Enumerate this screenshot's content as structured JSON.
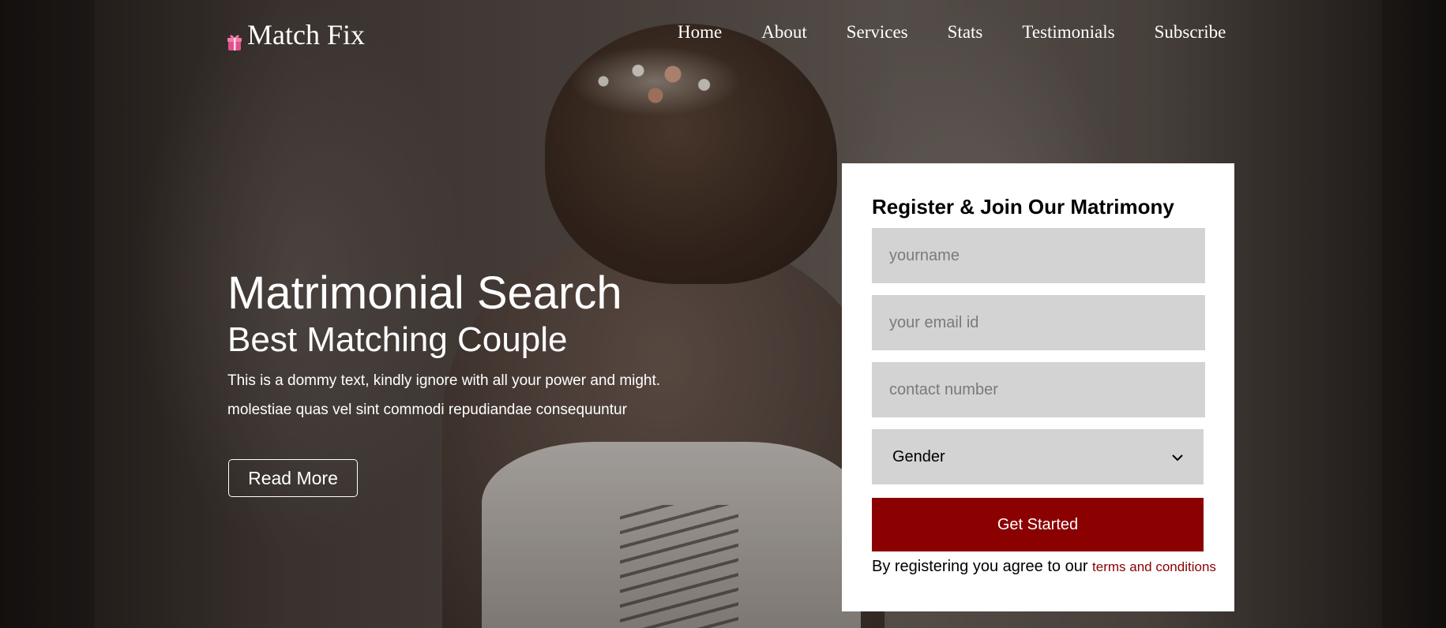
{
  "brand": {
    "name": "Match Fix",
    "icon": "gift-icon",
    "icon_color": "#e0508c"
  },
  "nav": {
    "items": [
      {
        "label": "Home"
      },
      {
        "label": "About"
      },
      {
        "label": "Services"
      },
      {
        "label": "Stats"
      },
      {
        "label": "Testimonials"
      },
      {
        "label": "Subscribe"
      }
    ]
  },
  "hero": {
    "title": "Matrimonial Search",
    "subtitle": "Best Matching Couple",
    "line1": "This is a dommy text, kindly ignore with all your power and might.",
    "line2": "molestiae quas vel sint commodi repudiandae consequuntur",
    "cta_label": "Read More"
  },
  "register": {
    "title": "Register & Join Our Matrimony",
    "name_placeholder": "yourname",
    "email_placeholder": "your email id",
    "phone_placeholder": "contact number",
    "gender_selected": "Gender",
    "submit_label": "Get Started",
    "terms_prefix": "By registering you agree to our ",
    "terms_link": "terms and conditions"
  },
  "colors": {
    "accent": "#8b0000",
    "card_bg": "#ffffff",
    "field_bg": "#d3d3d3"
  }
}
